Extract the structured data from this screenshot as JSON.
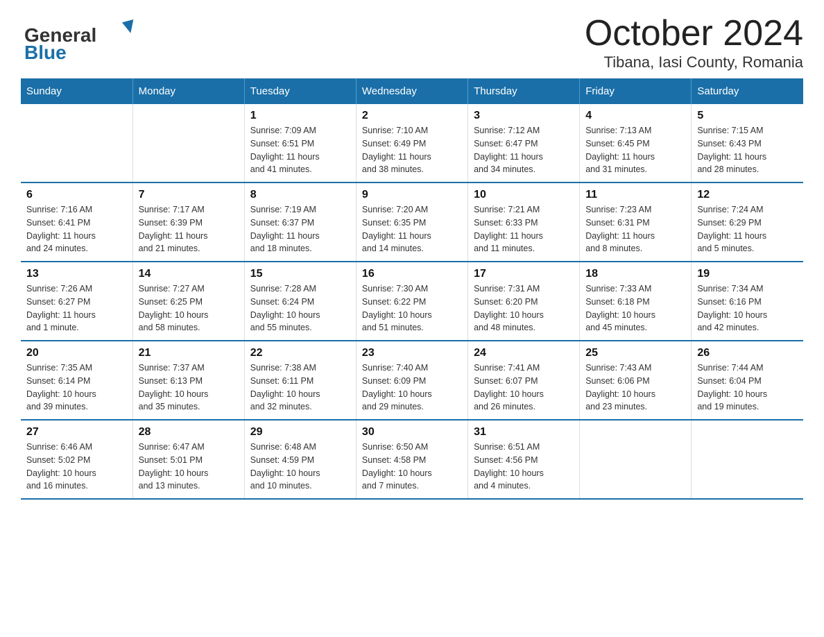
{
  "header": {
    "logo_general": "General",
    "logo_blue": "Blue",
    "title": "October 2024",
    "subtitle": "Tibana, Iasi County, Romania"
  },
  "days_of_week": [
    "Sunday",
    "Monday",
    "Tuesday",
    "Wednesday",
    "Thursday",
    "Friday",
    "Saturday"
  ],
  "weeks": [
    [
      {
        "num": "",
        "info": ""
      },
      {
        "num": "",
        "info": ""
      },
      {
        "num": "1",
        "info": "Sunrise: 7:09 AM\nSunset: 6:51 PM\nDaylight: 11 hours\nand 41 minutes."
      },
      {
        "num": "2",
        "info": "Sunrise: 7:10 AM\nSunset: 6:49 PM\nDaylight: 11 hours\nand 38 minutes."
      },
      {
        "num": "3",
        "info": "Sunrise: 7:12 AM\nSunset: 6:47 PM\nDaylight: 11 hours\nand 34 minutes."
      },
      {
        "num": "4",
        "info": "Sunrise: 7:13 AM\nSunset: 6:45 PM\nDaylight: 11 hours\nand 31 minutes."
      },
      {
        "num": "5",
        "info": "Sunrise: 7:15 AM\nSunset: 6:43 PM\nDaylight: 11 hours\nand 28 minutes."
      }
    ],
    [
      {
        "num": "6",
        "info": "Sunrise: 7:16 AM\nSunset: 6:41 PM\nDaylight: 11 hours\nand 24 minutes."
      },
      {
        "num": "7",
        "info": "Sunrise: 7:17 AM\nSunset: 6:39 PM\nDaylight: 11 hours\nand 21 minutes."
      },
      {
        "num": "8",
        "info": "Sunrise: 7:19 AM\nSunset: 6:37 PM\nDaylight: 11 hours\nand 18 minutes."
      },
      {
        "num": "9",
        "info": "Sunrise: 7:20 AM\nSunset: 6:35 PM\nDaylight: 11 hours\nand 14 minutes."
      },
      {
        "num": "10",
        "info": "Sunrise: 7:21 AM\nSunset: 6:33 PM\nDaylight: 11 hours\nand 11 minutes."
      },
      {
        "num": "11",
        "info": "Sunrise: 7:23 AM\nSunset: 6:31 PM\nDaylight: 11 hours\nand 8 minutes."
      },
      {
        "num": "12",
        "info": "Sunrise: 7:24 AM\nSunset: 6:29 PM\nDaylight: 11 hours\nand 5 minutes."
      }
    ],
    [
      {
        "num": "13",
        "info": "Sunrise: 7:26 AM\nSunset: 6:27 PM\nDaylight: 11 hours\nand 1 minute."
      },
      {
        "num": "14",
        "info": "Sunrise: 7:27 AM\nSunset: 6:25 PM\nDaylight: 10 hours\nand 58 minutes."
      },
      {
        "num": "15",
        "info": "Sunrise: 7:28 AM\nSunset: 6:24 PM\nDaylight: 10 hours\nand 55 minutes."
      },
      {
        "num": "16",
        "info": "Sunrise: 7:30 AM\nSunset: 6:22 PM\nDaylight: 10 hours\nand 51 minutes."
      },
      {
        "num": "17",
        "info": "Sunrise: 7:31 AM\nSunset: 6:20 PM\nDaylight: 10 hours\nand 48 minutes."
      },
      {
        "num": "18",
        "info": "Sunrise: 7:33 AM\nSunset: 6:18 PM\nDaylight: 10 hours\nand 45 minutes."
      },
      {
        "num": "19",
        "info": "Sunrise: 7:34 AM\nSunset: 6:16 PM\nDaylight: 10 hours\nand 42 minutes."
      }
    ],
    [
      {
        "num": "20",
        "info": "Sunrise: 7:35 AM\nSunset: 6:14 PM\nDaylight: 10 hours\nand 39 minutes."
      },
      {
        "num": "21",
        "info": "Sunrise: 7:37 AM\nSunset: 6:13 PM\nDaylight: 10 hours\nand 35 minutes."
      },
      {
        "num": "22",
        "info": "Sunrise: 7:38 AM\nSunset: 6:11 PM\nDaylight: 10 hours\nand 32 minutes."
      },
      {
        "num": "23",
        "info": "Sunrise: 7:40 AM\nSunset: 6:09 PM\nDaylight: 10 hours\nand 29 minutes."
      },
      {
        "num": "24",
        "info": "Sunrise: 7:41 AM\nSunset: 6:07 PM\nDaylight: 10 hours\nand 26 minutes."
      },
      {
        "num": "25",
        "info": "Sunrise: 7:43 AM\nSunset: 6:06 PM\nDaylight: 10 hours\nand 23 minutes."
      },
      {
        "num": "26",
        "info": "Sunrise: 7:44 AM\nSunset: 6:04 PM\nDaylight: 10 hours\nand 19 minutes."
      }
    ],
    [
      {
        "num": "27",
        "info": "Sunrise: 6:46 AM\nSunset: 5:02 PM\nDaylight: 10 hours\nand 16 minutes."
      },
      {
        "num": "28",
        "info": "Sunrise: 6:47 AM\nSunset: 5:01 PM\nDaylight: 10 hours\nand 13 minutes."
      },
      {
        "num": "29",
        "info": "Sunrise: 6:48 AM\nSunset: 4:59 PM\nDaylight: 10 hours\nand 10 minutes."
      },
      {
        "num": "30",
        "info": "Sunrise: 6:50 AM\nSunset: 4:58 PM\nDaylight: 10 hours\nand 7 minutes."
      },
      {
        "num": "31",
        "info": "Sunrise: 6:51 AM\nSunset: 4:56 PM\nDaylight: 10 hours\nand 4 minutes."
      },
      {
        "num": "",
        "info": ""
      },
      {
        "num": "",
        "info": ""
      }
    ]
  ]
}
